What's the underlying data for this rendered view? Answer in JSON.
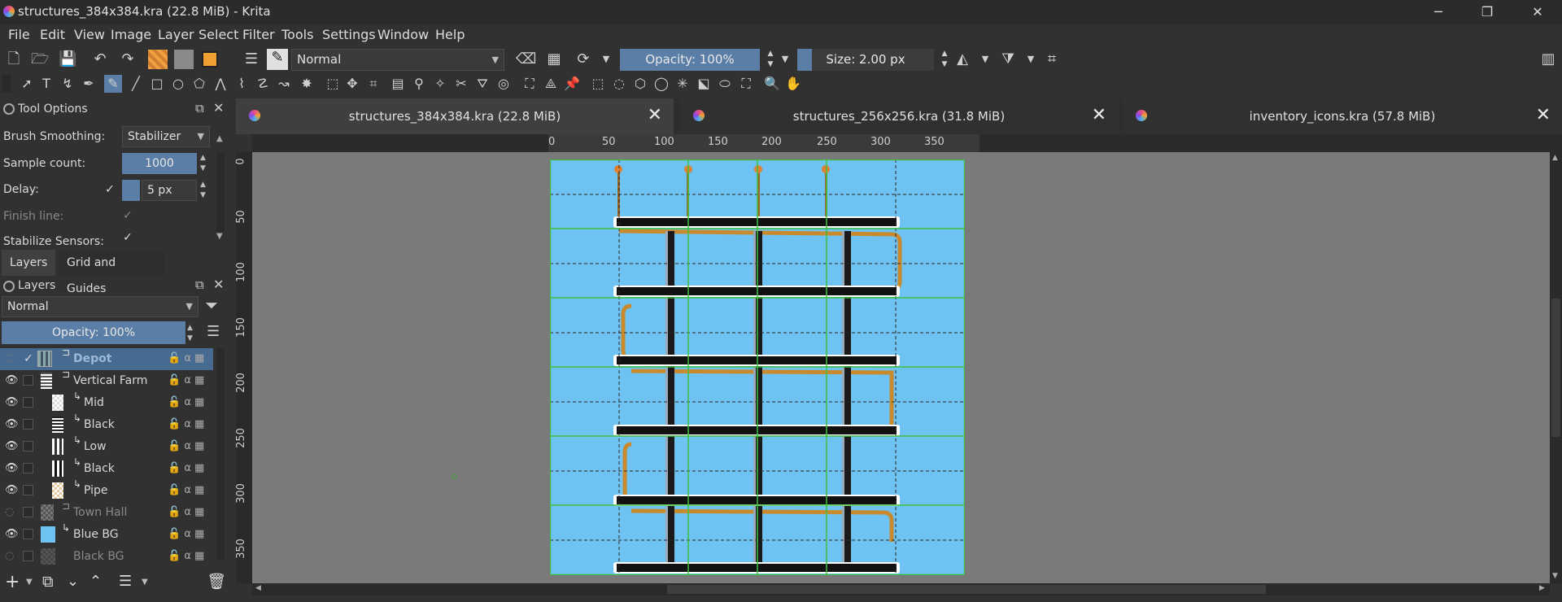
{
  "window": {
    "title": "structures_384x384.kra (22.8 MiB)  - Krita",
    "buttons": {
      "minimize": "─",
      "restore": "❐",
      "close": "✕"
    }
  },
  "menu": [
    "File",
    "Edit",
    "View",
    "Image",
    "Layer",
    "Select",
    "Filter",
    "Tools",
    "Settings",
    "Window",
    "Help"
  ],
  "toolbar": {
    "blend_mode": "Normal",
    "opacity": "Opacity: 100%",
    "size": "Size: 2.00 px"
  },
  "tool_options": {
    "title": "Tool Options",
    "brush_smoothing_label": "Brush Smoothing:",
    "brush_smoothing_value": "Stabilizer",
    "sample_count_label": "Sample count:",
    "sample_count_value": "1000",
    "delay_label": "Delay:",
    "delay_value": "5 px",
    "finish_line_label": "Finish line:",
    "stabilize_sensors_label": "Stabilize Sensors:"
  },
  "panel_tabs": [
    "Layers",
    "Grid and Guides"
  ],
  "layers_panel": {
    "title": "Layers",
    "blend_mode": "Normal",
    "opacity": "Opacity:  100%",
    "layers": [
      {
        "name": "Depot",
        "visible": false,
        "selected": true,
        "dim": false
      },
      {
        "name": "Vertical Farm",
        "visible": true,
        "selected": false,
        "dim": false
      },
      {
        "name": "Mid",
        "visible": true,
        "selected": false,
        "dim": false
      },
      {
        "name": "Black",
        "visible": true,
        "selected": false,
        "dim": false
      },
      {
        "name": "Low",
        "visible": true,
        "selected": false,
        "dim": false
      },
      {
        "name": "Black",
        "visible": true,
        "selected": false,
        "dim": false
      },
      {
        "name": "Pipe",
        "visible": true,
        "selected": false,
        "dim": false
      },
      {
        "name": "Town Hall",
        "visible": false,
        "selected": false,
        "dim": true
      },
      {
        "name": "Blue BG",
        "visible": true,
        "selected": false,
        "dim": false
      },
      {
        "name": "Black BG",
        "visible": false,
        "selected": false,
        "dim": true
      }
    ]
  },
  "document_tabs": [
    {
      "label": "structures_384x384.kra (22.8 MiB)",
      "active": true
    },
    {
      "label": "structures_256x256.kra (31.8 MiB)",
      "active": false
    },
    {
      "label": "inventory_icons.kra (57.8 MiB)",
      "active": false
    }
  ],
  "ruler": {
    "top_ticks": [
      "0",
      "50",
      "100",
      "150",
      "200",
      "250",
      "300",
      "350"
    ],
    "left_ticks": [
      "0",
      "50",
      "100",
      "150",
      "200",
      "250",
      "300",
      "350"
    ]
  },
  "colors": {
    "accent": "#5b7ea6",
    "canvas_bg": "#6ec3f3",
    "guide": "#3fbf3f"
  }
}
